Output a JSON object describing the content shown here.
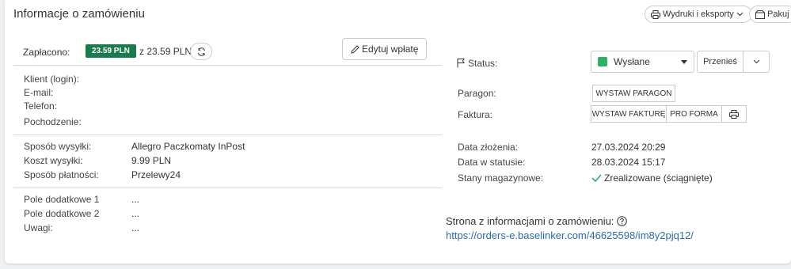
{
  "header": {
    "title": "Informacje o zamówieniu",
    "prints_button": "Wydruki i eksporty",
    "pack_button": "Pakuj"
  },
  "payment": {
    "label": "Zapłacono:",
    "paid_amount": "23.59 PLN",
    "total_text": "z 23.59 PLN",
    "edit_button": "Edytuj wpłatę"
  },
  "customer": {
    "rows": [
      {
        "label": "Klient (login):",
        "value": ""
      },
      {
        "label": "E-mail:",
        "value": ""
      },
      {
        "label": "Telefon:",
        "value": ""
      },
      {
        "label": "Pochodzenie:",
        "value": ""
      }
    ]
  },
  "shipping": {
    "rows": [
      {
        "label": "Sposób wysyłki:",
        "value": "Allegro Paczkomaty InPost"
      },
      {
        "label": "Koszt wysyłki:",
        "value": "9.99 PLN"
      },
      {
        "label": "Sposób płatności:",
        "value": "Przelewy24"
      }
    ]
  },
  "extra": {
    "rows": [
      {
        "label": "Pole dodatkowe 1",
        "value": "..."
      },
      {
        "label": "Pole dodatkowe 2",
        "value": "..."
      },
      {
        "label": "Uwagi:",
        "value": "..."
      }
    ]
  },
  "status": {
    "label": "Status:",
    "value": "Wysłane",
    "color": "#2db067",
    "move_button": "Przenieś"
  },
  "receipt": {
    "label": "Paragon:",
    "button": "WYSTAW PARAGON"
  },
  "invoice": {
    "label": "Faktura:",
    "issue_button": "WYSTAW FAKTURĘ",
    "proforma_button": "PRO FORMA"
  },
  "dates": {
    "created_label": "Data złożenia:",
    "created_value": "27.03.2024 20:29",
    "status_label": "Data w statusie:",
    "status_value": "28.03.2024 15:17",
    "stock_label": "Stany magazynowe:",
    "stock_value": "Zrealizowane (ściągnięte)"
  },
  "order_page": {
    "title": "Strona z informacjami o zamówieniu:",
    "url": "https://orders-e.baselinker.com/46625598/im8y2pjq12/"
  }
}
